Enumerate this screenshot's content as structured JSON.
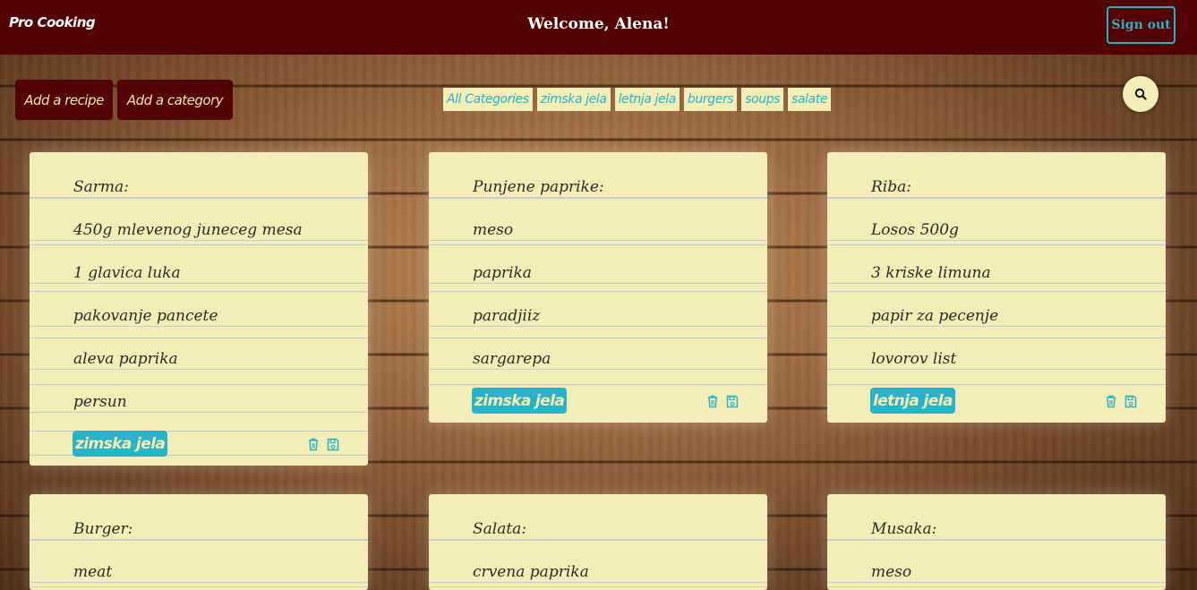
{
  "header": {
    "brand": "Pro Cooking",
    "welcome": "Welcome, Alena!",
    "sign_out": "Sign out"
  },
  "toolbar": {
    "add_recipe": "Add a recipe",
    "add_category": "Add a category",
    "search_icon": "search-icon"
  },
  "categories": [
    "All Categories",
    "zimska jela",
    "letnja jela",
    "burgers",
    "soups",
    "salate"
  ],
  "recipes": [
    {
      "title": "Sarma:",
      "ingredients": [
        "450g mlevenog juneceg mesa",
        "1 glavica luka",
        "pakovanje pancete",
        "aleva paprika",
        "persun"
      ],
      "category": "zimska jela"
    },
    {
      "title": "Punjene paprike:",
      "ingredients": [
        "meso",
        "paprika",
        "paradjiiz",
        "sargarepa"
      ],
      "category": "zimska jela"
    },
    {
      "title": "Riba:",
      "ingredients": [
        "Losos 500g",
        "3 kriske limuna",
        "papir za pecenje",
        "lovorov list"
      ],
      "category": "letnja jela"
    },
    {
      "title": "Burger:",
      "ingredients": [
        "meat"
      ],
      "category": ""
    },
    {
      "title": "Salata:",
      "ingredients": [
        "crvena paprika"
      ],
      "category": ""
    },
    {
      "title": "Musaka:",
      "ingredients": [
        "meso"
      ],
      "category": ""
    }
  ],
  "colors": {
    "header_bg": "#520203",
    "accent": "#2ab3c7",
    "card_bg": "#f3eeb7",
    "button_text": "#f3e9a2"
  }
}
